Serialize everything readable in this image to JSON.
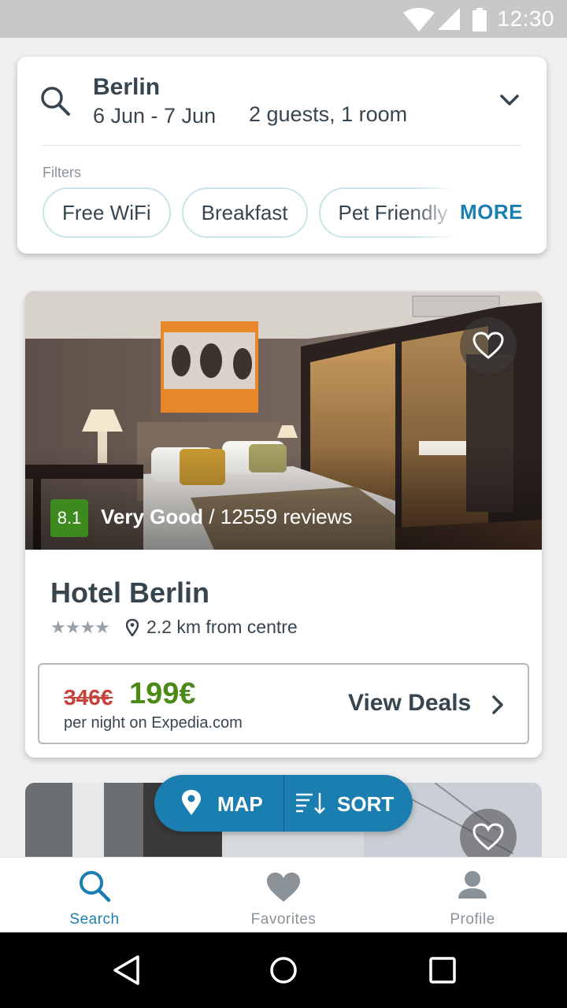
{
  "status_bar": {
    "time": "12:30"
  },
  "search": {
    "city": "Berlin",
    "dates": "6 Jun - 7 Jun",
    "guests": "2 guests, 1 room",
    "filters_label": "Filters",
    "chips": [
      "Free WiFi",
      "Breakfast",
      "Pet Friendly"
    ],
    "more_label": "MORE"
  },
  "hotel": {
    "rating_score": "8.1",
    "rating_word": "Very Good",
    "reviews": "/ 12559 reviews",
    "name": "Hotel Berlin",
    "stars": "★★★★",
    "distance": "2.2 km from centre",
    "old_price": "346€",
    "new_price": "199€",
    "price_sub": "per night on Expedia.com",
    "view_deals": "View Deals"
  },
  "fab": {
    "map_label": "MAP",
    "sort_label": "SORT"
  },
  "bottom_nav": {
    "search_label": "Search",
    "favorites_label": "Favorites",
    "profile_label": "Profile"
  },
  "colors": {
    "accent": "#1a7fb0",
    "rating_green": "#3d8a1f",
    "price_green": "#4c8a16",
    "old_price_red": "#c4433a",
    "text_dark": "#37454f"
  }
}
